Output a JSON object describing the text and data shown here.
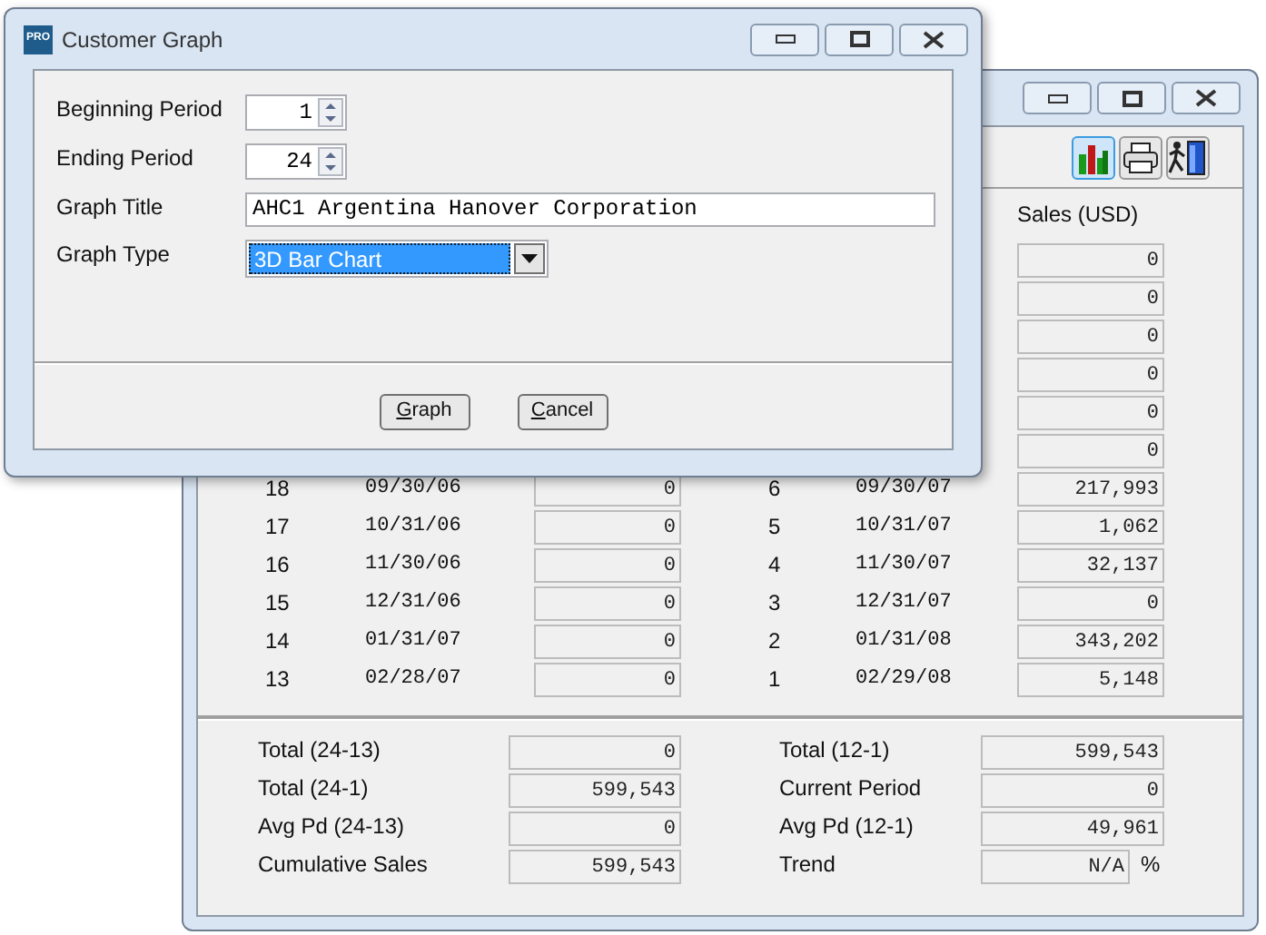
{
  "sales_window": {
    "toolbar": [
      {
        "kind": "chart",
        "selected": true
      },
      {
        "kind": "print",
        "selected": false
      },
      {
        "kind": "exit",
        "selected": false
      }
    ],
    "column_header": "Sales (USD)",
    "upper_rows": [
      {
        "value": "0"
      },
      {
        "value": "0"
      },
      {
        "value": "0"
      },
      {
        "value": "0"
      },
      {
        "value": "0"
      },
      {
        "value": "0"
      }
    ],
    "rows": [
      {
        "left": {
          "period": "18",
          "date": "09/30/06",
          "value": "0"
        },
        "right": {
          "period": "6",
          "date": "09/30/07",
          "value": "217,993"
        }
      },
      {
        "left": {
          "period": "17",
          "date": "10/31/06",
          "value": "0"
        },
        "right": {
          "period": "5",
          "date": "10/31/07",
          "value": "1,062"
        }
      },
      {
        "left": {
          "period": "16",
          "date": "11/30/06",
          "value": "0"
        },
        "right": {
          "period": "4",
          "date": "11/30/07",
          "value": "32,137"
        }
      },
      {
        "left": {
          "period": "15",
          "date": "12/31/06",
          "value": "0"
        },
        "right": {
          "period": "3",
          "date": "12/31/07",
          "value": "0"
        }
      },
      {
        "left": {
          "period": "14",
          "date": "01/31/07",
          "value": "0"
        },
        "right": {
          "period": "2",
          "date": "01/31/08",
          "value": "343,202"
        }
      },
      {
        "left": {
          "period": "13",
          "date": "02/28/07",
          "value": "0"
        },
        "right": {
          "period": "1",
          "date": "02/29/08",
          "value": "5,148"
        }
      }
    ],
    "totals": [
      {
        "left": {
          "label": "Total (24-13)",
          "value": "0"
        },
        "right": {
          "label": "Total (12-1)",
          "value": "599,543"
        }
      },
      {
        "left": {
          "label": "Total (24-1)",
          "value": "599,543"
        },
        "right": {
          "label": "Current Period",
          "value": "0"
        }
      },
      {
        "left": {
          "label": "Avg Pd (24-13)",
          "value": "0"
        },
        "right": {
          "label": "Avg Pd (12-1)",
          "value": "49,961"
        }
      },
      {
        "left": {
          "label": "Cumulative Sales",
          "value": "599,543"
        },
        "right": {
          "label": "Trend",
          "value": "N/A",
          "unit": "%"
        }
      }
    ]
  },
  "dialog": {
    "app_badge": "PRO",
    "title": "Customer Graph",
    "fields": [
      {
        "kind": "spinner",
        "label": "Beginning Period",
        "value": "1"
      },
      {
        "kind": "spinner",
        "label": "Ending Period",
        "value": "24"
      },
      {
        "kind": "text",
        "label": "Graph Title",
        "value": "AHC1 Argentina Hanover Corporation"
      },
      {
        "kind": "dropdown",
        "label": "Graph Type",
        "value": "3D Bar Chart"
      }
    ],
    "buttons": [
      "Graph",
      "Cancel"
    ]
  }
}
